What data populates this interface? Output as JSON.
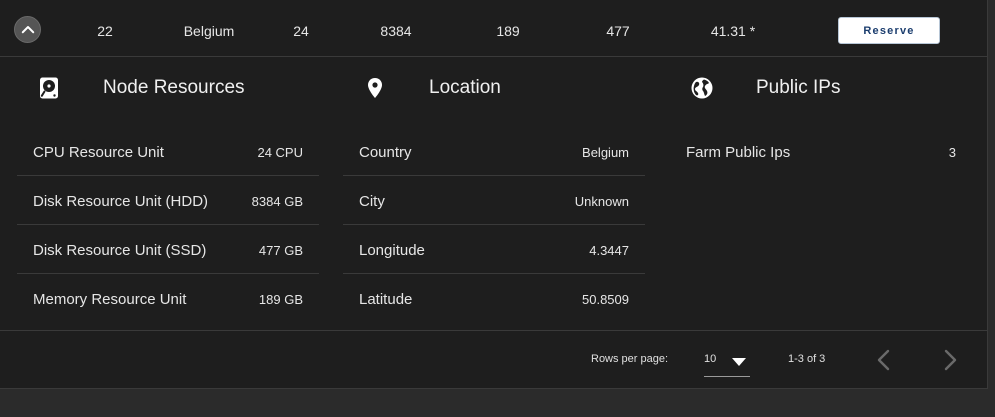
{
  "row": {
    "id": "22",
    "country": "Belgium",
    "cru": "24",
    "hru": "8384",
    "mru": "189",
    "sru": "477",
    "price": "41.31 *",
    "reserve_label": "Reserve"
  },
  "sections": {
    "node": {
      "title": "Node Resources",
      "icon": "harddisk-icon",
      "items": [
        {
          "label": "CPU Resource Unit",
          "value": "24 CPU"
        },
        {
          "label": "Disk Resource Unit (HDD)",
          "value": "8384 GB"
        },
        {
          "label": "Disk Resource Unit (SSD)",
          "value": "477 GB"
        },
        {
          "label": "Memory Resource Unit",
          "value": "189 GB"
        }
      ]
    },
    "location": {
      "title": "Location",
      "icon": "map-marker-icon",
      "items": [
        {
          "label": "Country",
          "value": "Belgium"
        },
        {
          "label": "City",
          "value": "Unknown"
        },
        {
          "label": "Longitude",
          "value": "4.3447"
        },
        {
          "label": "Latitude",
          "value": "50.8509"
        }
      ]
    },
    "ips": {
      "title": "Public IPs",
      "icon": "globe-icon",
      "items": [
        {
          "label": "Farm Public Ips",
          "value": "3"
        }
      ]
    }
  },
  "pagination": {
    "rows_per_page_label": "Rows per page:",
    "rows_per_page_value": "10",
    "range": "1-3 of 3"
  },
  "colors": {
    "card_bg": "#1e1e1e",
    "page_bg": "#2b2b2b",
    "divider": "#3a3a3a",
    "reserve_text": "#1b3d6e"
  }
}
